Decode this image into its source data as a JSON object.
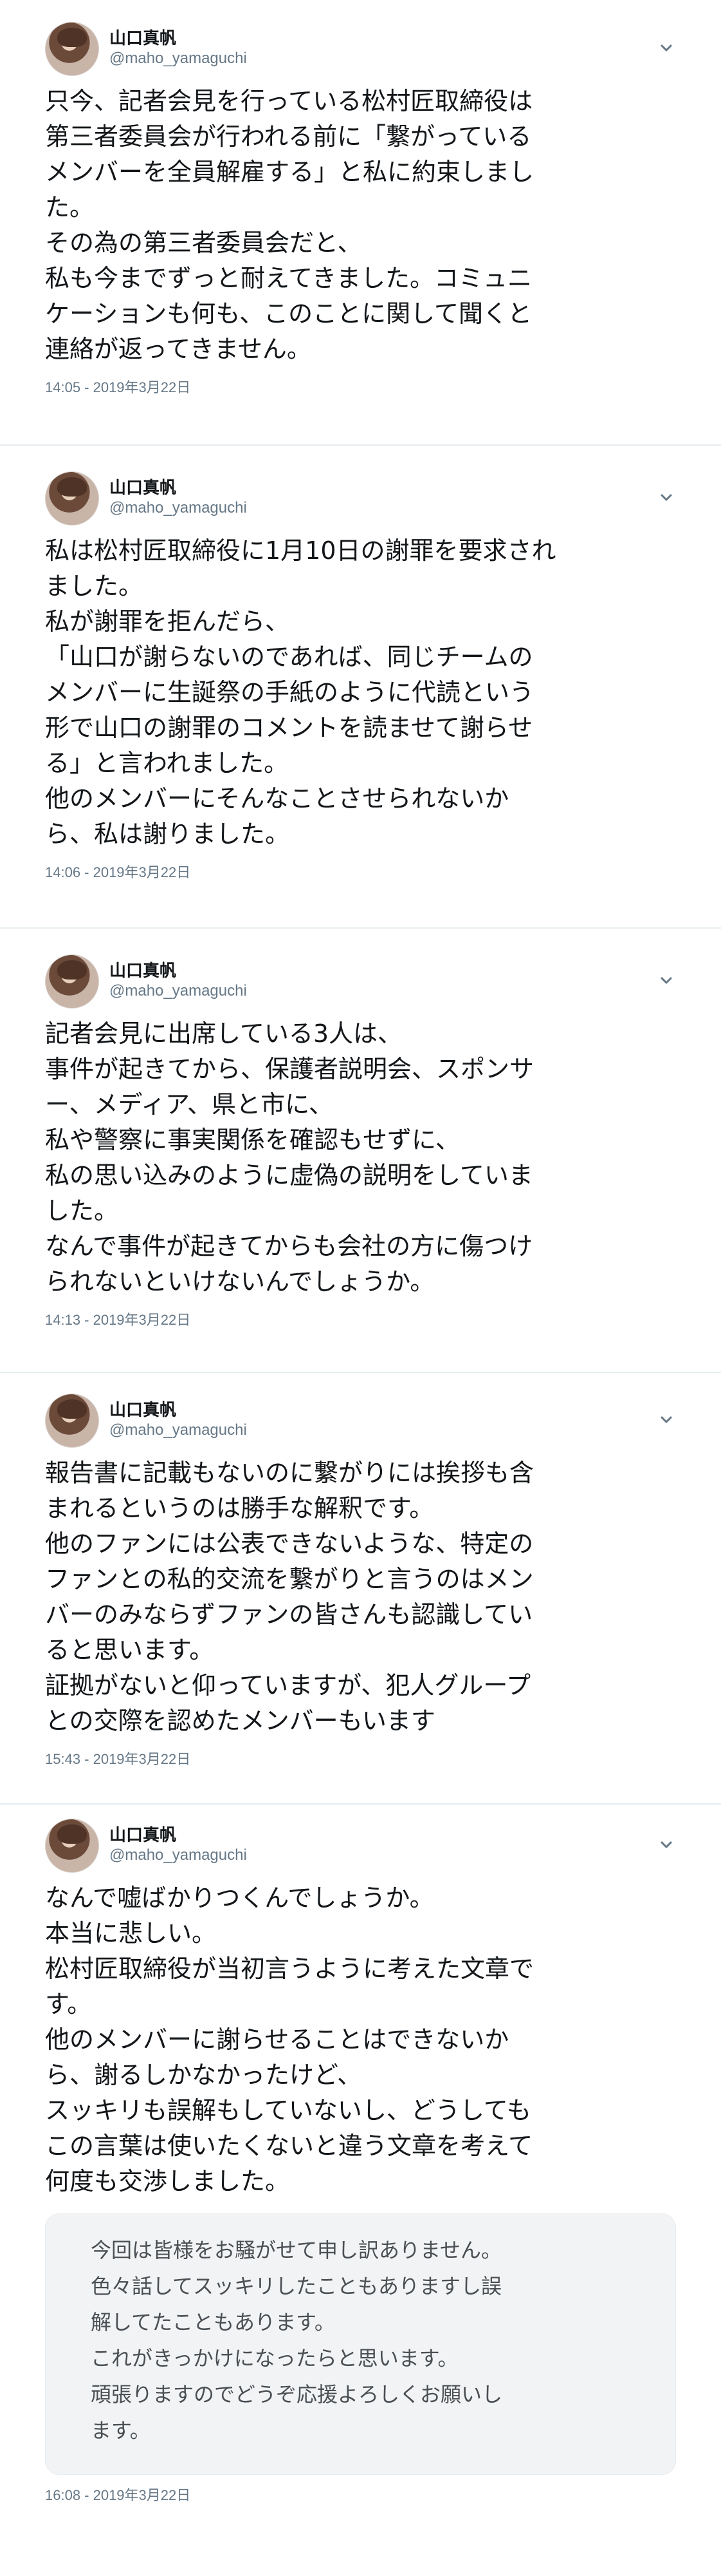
{
  "tweets": [
    {
      "display_name": "山口真帆",
      "handle": "@maho_yamaguchi",
      "text": "只今、記者会見を行っている松村匠取締役は\n第三者委員会が行われる前に「繋がっている\nメンバーを全員解雇する」と私に約束しまし\nた。\nその為の第三者委員会だと、\n私も今までずっと耐えてきました。コミュニ\nケーションも何も、このことに関して聞くと\n連絡が返ってきません。",
      "timestamp": "14:05 - 2019年3月22日"
    },
    {
      "display_name": "山口真帆",
      "handle": "@maho_yamaguchi",
      "text": "私は松村匠取締役に1月10日の謝罪を要求され\nました。\n私が謝罪を拒んだら、\n「山口が謝らないのであれば、同じチームの\nメンバーに生誕祭の手紙のように代読という\n形で山口の謝罪のコメントを読ませて謝らせ\nる」と言われました。\n他のメンバーにそんなことさせられないか\nら、私は謝りました。",
      "timestamp": "14:06 - 2019年3月22日"
    },
    {
      "display_name": "山口真帆",
      "handle": "@maho_yamaguchi",
      "text": "記者会見に出席している3人は、\n事件が起きてから、保護者説明会、スポンサ\nー、メディア、県と市に、\n私や警察に事実関係を確認もせずに、\n私の思い込みのように虚偽の説明をしていま\nした。\nなんで事件が起きてからも会社の方に傷つけ\nられないといけないんでしょうか。",
      "timestamp": "14:13 - 2019年3月22日"
    },
    {
      "display_name": "山口真帆",
      "handle": "@maho_yamaguchi",
      "text": "報告書に記載もないのに繋がりには挨拶も含\nまれるというのは勝手な解釈です。\n他のファンには公表できないような、特定の\nファンとの私的交流を繋がりと言うのはメン\nバーのみならずファンの皆さんも認識してい\nると思います。\n証拠がないと仰っていますが、犯人グループ\nとの交際を認めたメンバーもいます",
      "timestamp": "15:43 - 2019年3月22日"
    },
    {
      "display_name": "山口真帆",
      "handle": "@maho_yamaguchi",
      "text": "なんで嘘ばかりつくんでしょうか。\n本当に悲しい。\n松村匠取締役が当初言うように考えた文章で\nす。\n他のメンバーに謝らせることはできないか\nら、謝るしかなかったけど、\nスッキリも誤解もしていないし、どうしても\nこの言葉は使いたくないと違う文章を考えて\n何度も交渉しました。",
      "quote": "今回は皆様をお騒がせて申し訳ありません。\n色々話してスッキリしたこともありますし誤\n解してたこともあります。\nこれがきっかけになったらと思います。\n頑張りますのでどうぞ応援よろしくお願いし\nます。",
      "timestamp": "16:08 - 2019年3月22日"
    }
  ]
}
